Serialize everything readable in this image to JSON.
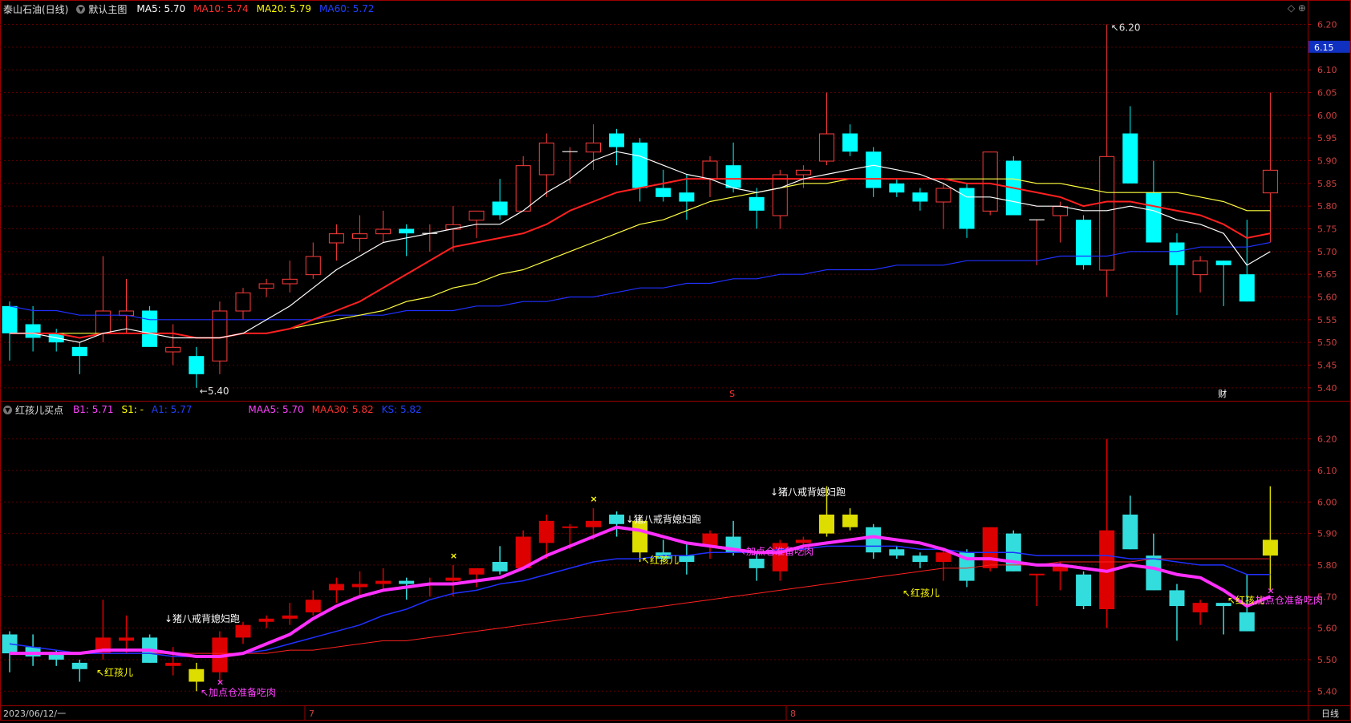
{
  "main_header": {
    "stock": "泰山石油(日线)",
    "template": "默认主图",
    "ma": [
      {
        "label": "MA5: 5.70",
        "color": "#ffffff"
      },
      {
        "label": "MA10: 5.74",
        "color": "#ff3030"
      },
      {
        "label": "MA20: 5.79",
        "color": "#ffff00"
      },
      {
        "label": "MA60: 5.72",
        "color": "#2040ff"
      }
    ]
  },
  "sub_header": {
    "indicator": "红孩儿买点",
    "params": [
      {
        "label": "B1: 5.71",
        "color": "#ff40ff"
      },
      {
        "label": "S1: -",
        "color": "#ffff00"
      },
      {
        "label": "A1: 5.77",
        "color": "#2040ff"
      },
      {
        "label": "MAA5: 5.70",
        "color": "#ff40ff"
      },
      {
        "label": "MAA30: 5.82",
        "color": "#ff3030"
      },
      {
        "label": "KS: 5.82",
        "color": "#2040ff"
      }
    ]
  },
  "top_icons": "◇ ⊕",
  "price_tag": "6.15",
  "main_axis": [
    "6.20",
    "6.15",
    "6.10",
    "6.05",
    "6.00",
    "5.95",
    "5.90",
    "5.85",
    "5.80",
    "5.75",
    "5.70",
    "5.65",
    "5.60",
    "5.55",
    "5.50",
    "5.45",
    "5.40"
  ],
  "sub_axis": [
    "6.20",
    "6.10",
    "6.00",
    "5.90",
    "5.80",
    "5.70",
    "5.60",
    "5.50",
    "5.40"
  ],
  "high_label": "6.20",
  "low_label": "5.40",
  "markers": {
    "s": "S",
    "cai": "财"
  },
  "bottom": {
    "date": "2023/06/12/一",
    "months": [
      "7",
      "8"
    ],
    "period": "日线"
  },
  "signals": [
    {
      "text": "↖红孩儿",
      "color": "#ffff00",
      "chart": "sub",
      "idx": 4,
      "below": true
    },
    {
      "text": "↓猪八戒背媳妇跑",
      "color": "#ffffff",
      "chart": "sub",
      "idx": 9,
      "above": true
    },
    {
      "text": "↖加点仓准备吃肉",
      "color": "#ff40ff",
      "chart": "sub",
      "idx": 9,
      "below": true,
      "extra": true
    },
    {
      "text": "↓猪八戒背媳妇跑",
      "color": "#ffffff",
      "chart": "sub",
      "idx": 27,
      "above": true
    },
    {
      "text": "↖红孩儿",
      "color": "#ffff00",
      "chart": "sub",
      "idx": 29,
      "below": true
    },
    {
      "text": "↓猪八戒背媳妇跑",
      "color": "#ffffff",
      "chart": "sub",
      "idx": 35,
      "above": true
    },
    {
      "text": "↖加点仓准备吃肉",
      "color": "#ff40ff",
      "chart": "sub",
      "idx": 35,
      "below": true
    },
    {
      "text": "↖红孩儿",
      "color": "#ffff00",
      "chart": "sub",
      "idx": 39,
      "below": true
    },
    {
      "text": "↖红孩儿",
      "color": "#ffff00",
      "chart": "sub",
      "idx": 53,
      "below": true
    },
    {
      "text": "↖加点仓准备吃肉",
      "color": "#ff40ff",
      "chart": "sub",
      "idx": 53,
      "below": true,
      "extra": true
    }
  ],
  "chart_data": {
    "type": "candlestick",
    "period": "daily",
    "candles": [
      {
        "o": 5.58,
        "h": 5.59,
        "l": 5.46,
        "c": 5.52
      },
      {
        "o": 5.54,
        "h": 5.58,
        "l": 5.48,
        "c": 5.51
      },
      {
        "o": 5.52,
        "h": 5.53,
        "l": 5.48,
        "c": 5.5
      },
      {
        "o": 5.49,
        "h": 5.5,
        "l": 5.43,
        "c": 5.47
      },
      {
        "o": 5.52,
        "h": 5.69,
        "l": 5.5,
        "c": 5.57
      },
      {
        "o": 5.56,
        "h": 5.64,
        "l": 5.52,
        "c": 5.57
      },
      {
        "o": 5.57,
        "h": 5.58,
        "l": 5.49,
        "c": 5.49
      },
      {
        "o": 5.48,
        "h": 5.54,
        "l": 5.45,
        "c": 5.49
      },
      {
        "o": 5.47,
        "h": 5.49,
        "l": 5.4,
        "c": 5.43
      },
      {
        "o": 5.46,
        "h": 5.59,
        "l": 5.43,
        "c": 5.57
      },
      {
        "o": 5.57,
        "h": 5.62,
        "l": 5.55,
        "c": 5.61
      },
      {
        "o": 5.62,
        "h": 5.64,
        "l": 5.6,
        "c": 5.63
      },
      {
        "o": 5.63,
        "h": 5.68,
        "l": 5.61,
        "c": 5.64
      },
      {
        "o": 5.65,
        "h": 5.72,
        "l": 5.64,
        "c": 5.69
      },
      {
        "o": 5.72,
        "h": 5.76,
        "l": 5.68,
        "c": 5.74
      },
      {
        "o": 5.73,
        "h": 5.78,
        "l": 5.7,
        "c": 5.74
      },
      {
        "o": 5.74,
        "h": 5.79,
        "l": 5.72,
        "c": 5.75
      },
      {
        "o": 5.75,
        "h": 5.76,
        "l": 5.69,
        "c": 5.74
      },
      {
        "o": 5.74,
        "h": 5.76,
        "l": 5.7,
        "c": 5.74
      },
      {
        "o": 5.75,
        "h": 5.8,
        "l": 5.7,
        "c": 5.76
      },
      {
        "o": 5.77,
        "h": 5.79,
        "l": 5.73,
        "c": 5.79
      },
      {
        "o": 5.81,
        "h": 5.86,
        "l": 5.77,
        "c": 5.78
      },
      {
        "o": 5.79,
        "h": 5.91,
        "l": 5.79,
        "c": 5.89
      },
      {
        "o": 5.87,
        "h": 5.96,
        "l": 5.82,
        "c": 5.94
      },
      {
        "o": 5.92,
        "h": 5.93,
        "l": 5.85,
        "c": 5.92
      },
      {
        "o": 5.92,
        "h": 5.98,
        "l": 5.88,
        "c": 5.94
      },
      {
        "o": 5.96,
        "h": 5.97,
        "l": 5.89,
        "c": 5.93
      },
      {
        "o": 5.94,
        "h": 5.95,
        "l": 5.81,
        "c": 5.84
      },
      {
        "o": 5.84,
        "h": 5.88,
        "l": 5.81,
        "c": 5.82
      },
      {
        "o": 5.83,
        "h": 5.87,
        "l": 5.77,
        "c": 5.81
      },
      {
        "o": 5.86,
        "h": 5.91,
        "l": 5.82,
        "c": 5.9
      },
      {
        "o": 5.89,
        "h": 5.94,
        "l": 5.83,
        "c": 5.84
      },
      {
        "o": 5.82,
        "h": 5.84,
        "l": 5.75,
        "c": 5.79
      },
      {
        "o": 5.78,
        "h": 5.88,
        "l": 5.75,
        "c": 5.87
      },
      {
        "o": 5.87,
        "h": 5.89,
        "l": 5.84,
        "c": 5.88
      },
      {
        "o": 5.9,
        "h": 6.05,
        "l": 5.89,
        "c": 5.96
      },
      {
        "o": 5.96,
        "h": 5.98,
        "l": 5.91,
        "c": 5.92
      },
      {
        "o": 5.92,
        "h": 5.93,
        "l": 5.82,
        "c": 5.84
      },
      {
        "o": 5.85,
        "h": 5.86,
        "l": 5.82,
        "c": 5.83
      },
      {
        "o": 5.83,
        "h": 5.84,
        "l": 5.79,
        "c": 5.81
      },
      {
        "o": 5.81,
        "h": 5.85,
        "l": 5.75,
        "c": 5.84
      },
      {
        "o": 5.84,
        "h": 5.85,
        "l": 5.73,
        "c": 5.75
      },
      {
        "o": 5.79,
        "h": 5.92,
        "l": 5.78,
        "c": 5.92
      },
      {
        "o": 5.9,
        "h": 5.91,
        "l": 5.78,
        "c": 5.78
      },
      {
        "o": 5.77,
        "h": 5.77,
        "l": 5.67,
        "c": 5.77
      },
      {
        "o": 5.78,
        "h": 5.81,
        "l": 5.72,
        "c": 5.8
      },
      {
        "o": 5.77,
        "h": 5.78,
        "l": 5.66,
        "c": 5.67
      },
      {
        "o": 5.66,
        "h": 6.2,
        "l": 5.6,
        "c": 5.91
      },
      {
        "o": 5.96,
        "h": 6.02,
        "l": 5.85,
        "c": 5.85
      },
      {
        "o": 5.83,
        "h": 5.9,
        "l": 5.72,
        "c": 5.72
      },
      {
        "o": 5.72,
        "h": 5.74,
        "l": 5.56,
        "c": 5.67
      },
      {
        "o": 5.65,
        "h": 5.69,
        "l": 5.61,
        "c": 5.68
      },
      {
        "o": 5.68,
        "h": 5.68,
        "l": 5.58,
        "c": 5.67
      },
      {
        "o": 5.65,
        "h": 5.77,
        "l": 5.59,
        "c": 5.59
      },
      {
        "o": 5.83,
        "h": 6.05,
        "l": 5.72,
        "c": 5.88
      }
    ],
    "ma_lines": {
      "MA5": [
        5.52,
        5.52,
        5.51,
        5.5,
        5.52,
        5.53,
        5.52,
        5.51,
        5.51,
        5.51,
        5.52,
        5.55,
        5.58,
        5.62,
        5.66,
        5.69,
        5.72,
        5.73,
        5.74,
        5.75,
        5.76,
        5.76,
        5.79,
        5.83,
        5.86,
        5.9,
        5.92,
        5.91,
        5.89,
        5.87,
        5.86,
        5.84,
        5.83,
        5.84,
        5.86,
        5.87,
        5.88,
        5.89,
        5.88,
        5.87,
        5.85,
        5.82,
        5.82,
        5.81,
        5.8,
        5.8,
        5.79,
        5.79,
        5.8,
        5.79,
        5.77,
        5.76,
        5.74,
        5.67,
        5.7
      ],
      "MA10": [
        5.52,
        5.52,
        5.52,
        5.51,
        5.52,
        5.52,
        5.52,
        5.52,
        5.51,
        5.51,
        5.52,
        5.52,
        5.53,
        5.55,
        5.57,
        5.59,
        5.62,
        5.65,
        5.68,
        5.71,
        5.72,
        5.73,
        5.74,
        5.76,
        5.79,
        5.81,
        5.83,
        5.84,
        5.85,
        5.86,
        5.86,
        5.86,
        5.86,
        5.86,
        5.86,
        5.86,
        5.86,
        5.86,
        5.86,
        5.86,
        5.86,
        5.85,
        5.85,
        5.84,
        5.83,
        5.82,
        5.8,
        5.81,
        5.81,
        5.8,
        5.79,
        5.78,
        5.76,
        5.73,
        5.74
      ],
      "MA20": [
        5.52,
        5.52,
        5.52,
        5.52,
        5.52,
        5.52,
        5.52,
        5.52,
        5.51,
        5.51,
        5.52,
        5.52,
        5.53,
        5.54,
        5.55,
        5.56,
        5.57,
        5.59,
        5.6,
        5.62,
        5.63,
        5.65,
        5.66,
        5.68,
        5.7,
        5.72,
        5.74,
        5.76,
        5.77,
        5.79,
        5.81,
        5.82,
        5.83,
        5.84,
        5.85,
        5.85,
        5.86,
        5.86,
        5.86,
        5.86,
        5.86,
        5.86,
        5.86,
        5.86,
        5.85,
        5.85,
        5.84,
        5.83,
        5.83,
        5.83,
        5.83,
        5.82,
        5.81,
        5.79,
        5.79
      ],
      "MA60": [
        5.58,
        5.57,
        5.57,
        5.56,
        5.56,
        5.56,
        5.55,
        5.55,
        5.55,
        5.55,
        5.55,
        5.55,
        5.55,
        5.55,
        5.56,
        5.56,
        5.56,
        5.57,
        5.57,
        5.57,
        5.58,
        5.58,
        5.59,
        5.59,
        5.6,
        5.6,
        5.61,
        5.62,
        5.62,
        5.63,
        5.63,
        5.64,
        5.64,
        5.65,
        5.65,
        5.66,
        5.66,
        5.66,
        5.67,
        5.67,
        5.67,
        5.68,
        5.68,
        5.68,
        5.68,
        5.69,
        5.69,
        5.69,
        5.7,
        5.7,
        5.7,
        5.71,
        5.71,
        5.71,
        5.72
      ]
    },
    "sub_lines": {
      "MAA5": [
        5.52,
        5.52,
        5.52,
        5.52,
        5.53,
        5.53,
        5.53,
        5.52,
        5.51,
        5.51,
        5.52,
        5.55,
        5.58,
        5.63,
        5.67,
        5.7,
        5.72,
        5.73,
        5.74,
        5.74,
        5.75,
        5.76,
        5.79,
        5.83,
        5.86,
        5.89,
        5.92,
        5.91,
        5.89,
        5.87,
        5.86,
        5.85,
        5.84,
        5.84,
        5.86,
        5.87,
        5.88,
        5.89,
        5.88,
        5.87,
        5.85,
        5.82,
        5.82,
        5.81,
        5.8,
        5.8,
        5.79,
        5.78,
        5.8,
        5.79,
        5.77,
        5.76,
        5.72,
        5.67,
        5.7
      ],
      "MAA30": [
        5.52,
        5.52,
        5.52,
        5.52,
        5.52,
        5.52,
        5.52,
        5.52,
        5.52,
        5.52,
        5.52,
        5.52,
        5.53,
        5.53,
        5.54,
        5.55,
        5.56,
        5.56,
        5.57,
        5.58,
        5.59,
        5.6,
        5.61,
        5.62,
        5.63,
        5.64,
        5.65,
        5.66,
        5.67,
        5.68,
        5.69,
        5.7,
        5.71,
        5.72,
        5.73,
        5.74,
        5.75,
        5.76,
        5.77,
        5.78,
        5.79,
        5.79,
        5.8,
        5.8,
        5.8,
        5.81,
        5.81,
        5.81,
        5.81,
        5.82,
        5.82,
        5.82,
        5.82,
        5.82,
        5.82
      ],
      "KS": [
        5.55,
        5.54,
        5.53,
        5.52,
        5.52,
        5.52,
        5.52,
        5.51,
        5.51,
        5.51,
        5.52,
        5.53,
        5.55,
        5.57,
        5.59,
        5.61,
        5.64,
        5.66,
        5.69,
        5.71,
        5.72,
        5.74,
        5.75,
        5.77,
        5.79,
        5.81,
        5.82,
        5.82,
        5.83,
        5.83,
        5.84,
        5.84,
        5.84,
        5.85,
        5.85,
        5.86,
        5.86,
        5.86,
        5.86,
        5.85,
        5.85,
        5.84,
        5.84,
        5.84,
        5.83,
        5.83,
        5.83,
        5.83,
        5.82,
        5.82,
        5.81,
        5.8,
        5.8,
        5.77,
        5.77
      ]
    }
  },
  "colors": {
    "up": "#ff3b3b",
    "down": "#00ffff",
    "grid": "#5a0000",
    "frame": "#9a0000",
    "ma5": "#ffffff",
    "ma10": "#ff2020",
    "ma20": "#ffff40",
    "ma60": "#2030ff",
    "maa5": "#ff30ff",
    "maa30": "#ff2020",
    "ks": "#2030ff",
    "sub_up": "#dd0000",
    "sub_down": "#33dddd",
    "sub_yellow": "#dddd00"
  }
}
